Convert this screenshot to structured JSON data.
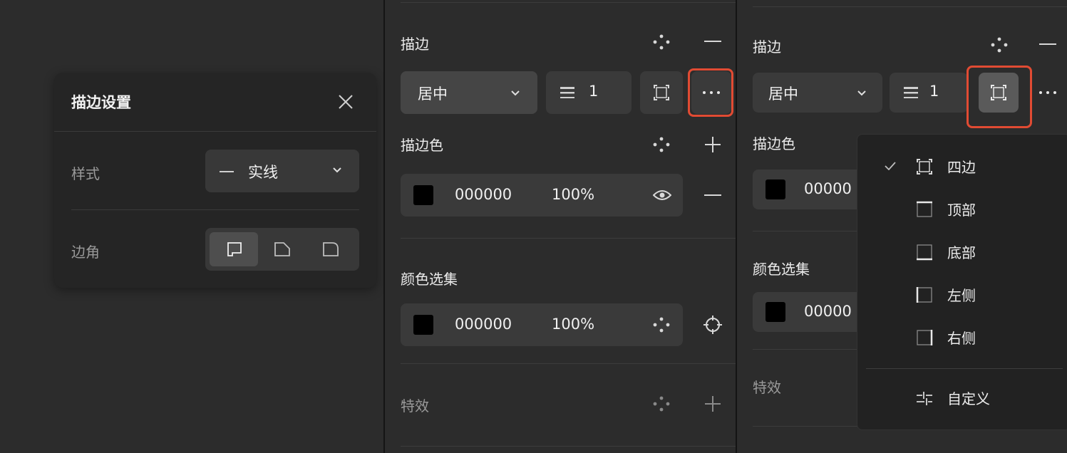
{
  "stroke_settings_panel": {
    "title": "描边设置",
    "style_label": "样式",
    "style_value": "实线",
    "corner_label": "边角"
  },
  "middle": {
    "stroke_title": "描边",
    "align_value": "居中",
    "width_value": "1",
    "stroke_color_title": "描边色",
    "stroke_color_hex": "000000",
    "stroke_color_opacity": "100%",
    "color_selection_title": "颜色选集",
    "selection_color_hex": "000000",
    "selection_color_opacity": "100%",
    "effects_title": "特效"
  },
  "right": {
    "stroke_title": "描边",
    "align_value": "居中",
    "width_value": "1",
    "stroke_color_title": "描边色",
    "stroke_color_hex": "00000",
    "color_selection_title": "颜色选集",
    "selection_color_hex": "00000",
    "effects_title": "特效"
  },
  "side_menu": {
    "items": [
      {
        "label": "四边",
        "checked": true
      },
      {
        "label": "顶部",
        "checked": false
      },
      {
        "label": "底部",
        "checked": false
      },
      {
        "label": "左侧",
        "checked": false
      },
      {
        "label": "右侧",
        "checked": false
      }
    ],
    "custom_label": "自定义"
  },
  "colors": {
    "background": "#2c2c2c",
    "panel": "#252525",
    "field": "#3a3a3a",
    "highlight": "#e14b33"
  }
}
